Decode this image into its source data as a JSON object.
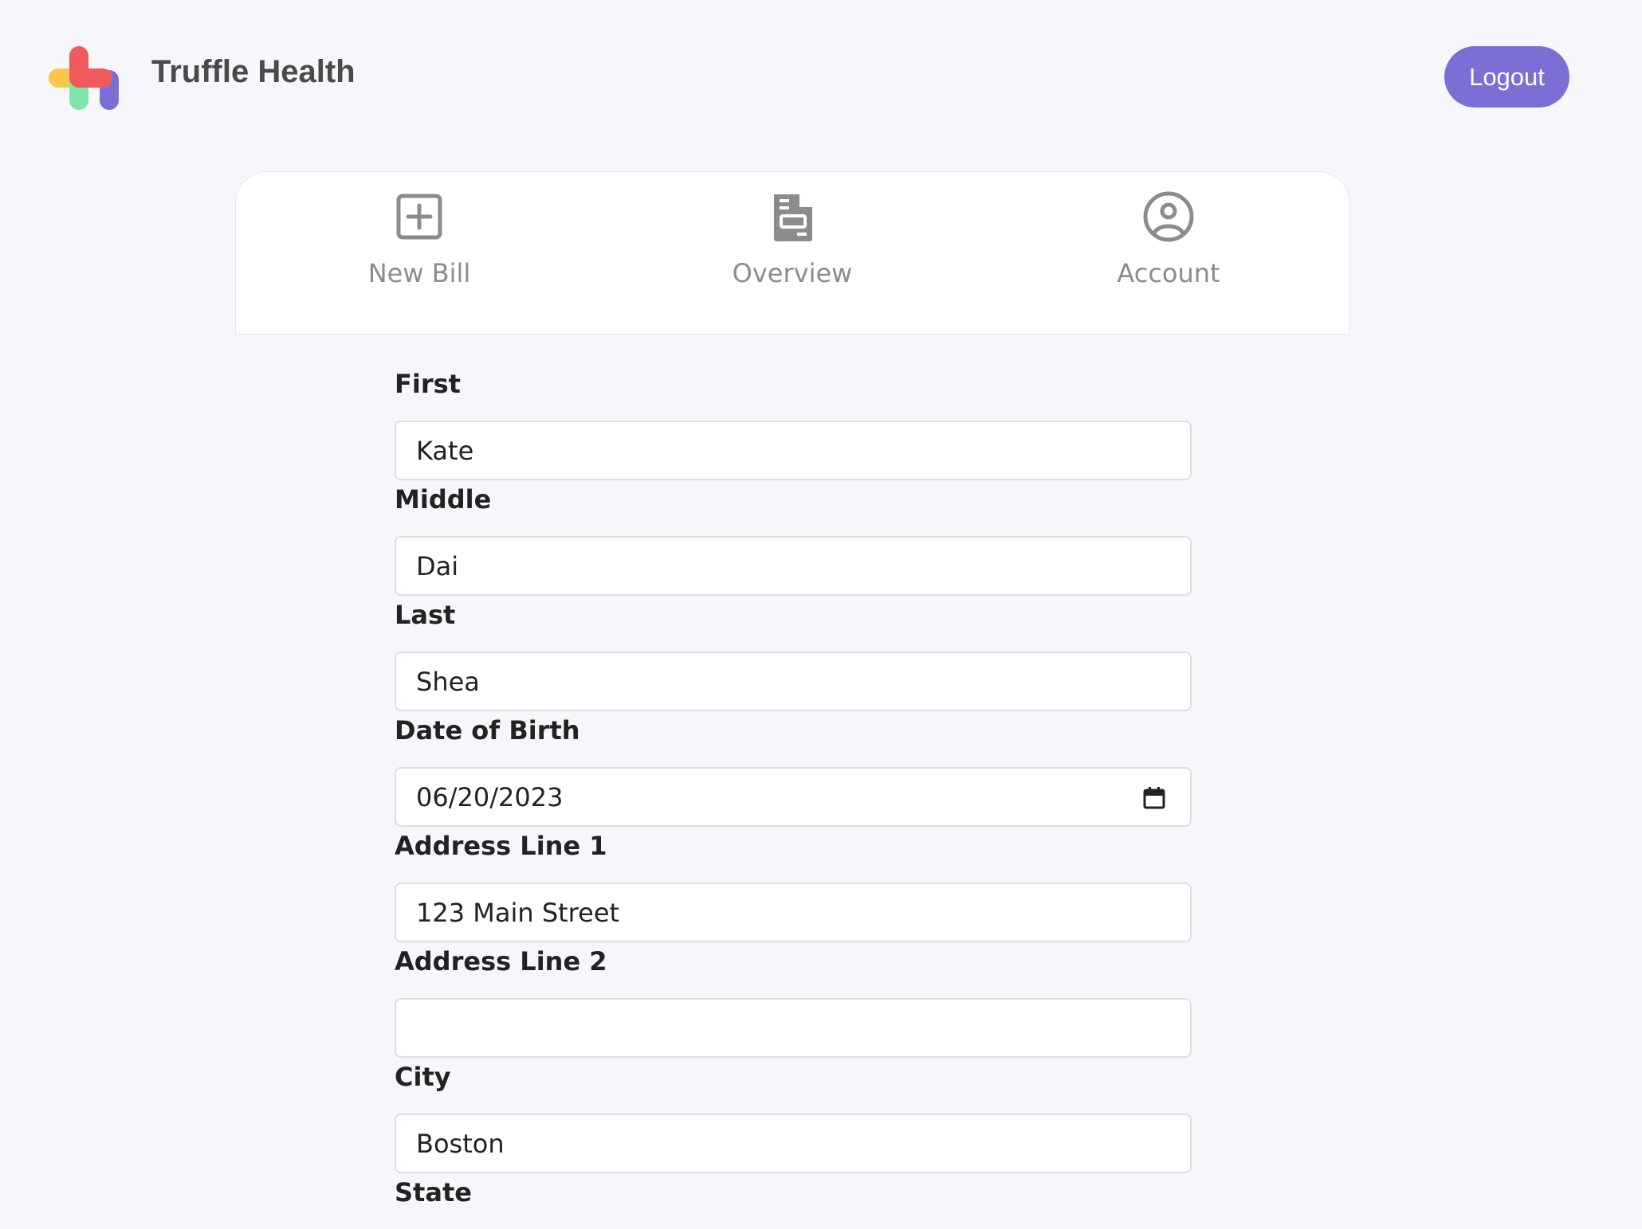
{
  "header": {
    "brand_name": "Truffle Health",
    "logout_label": "Logout"
  },
  "tabs": [
    {
      "label": "New Bill",
      "icon": "plus-square-icon"
    },
    {
      "label": "Overview",
      "icon": "document-icon"
    },
    {
      "label": "Account",
      "icon": "user-circle-icon"
    }
  ],
  "form": {
    "first": {
      "label": "First",
      "value": "Kate"
    },
    "middle": {
      "label": "Middle",
      "value": "Dai"
    },
    "last": {
      "label": "Last",
      "value": "Shea"
    },
    "dob": {
      "label": "Date of Birth",
      "value": "06/20/2023",
      "icon": "calendar-icon"
    },
    "address1": {
      "label": "Address Line 1",
      "value": "123 Main Street"
    },
    "address2": {
      "label": "Address Line 2",
      "value": ""
    },
    "city": {
      "label": "City",
      "value": "Boston"
    },
    "state": {
      "label": "State"
    }
  },
  "colors": {
    "background": "#f6f6fb",
    "accent": "#7b6fd6",
    "logo_red": "#ef5b5b",
    "logo_yellow": "#f7c948",
    "logo_green": "#7de8a6",
    "logo_purple": "#7b6fd6"
  }
}
